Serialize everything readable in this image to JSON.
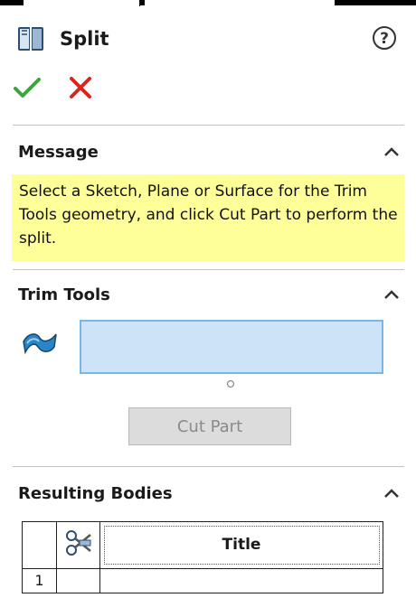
{
  "header": {
    "title": "Split",
    "feature_icon": "split-feature-icon",
    "help_icon": "help-icon"
  },
  "actions": {
    "ok_icon": "green-checkmark-icon",
    "cancel_icon": "red-x-icon"
  },
  "message_section": {
    "title": "Message",
    "text": "Select a Sketch, Plane or Surface for the Trim Tools geometry, and click Cut Part to perform the split.",
    "background_color": "#ffff99"
  },
  "trim_tools_section": {
    "title": "Trim Tools",
    "selection_value": "",
    "cut_button_label": "Cut Part"
  },
  "resulting_bodies_section": {
    "title": "Resulting Bodies",
    "table": {
      "columns": [
        "",
        "",
        "Title"
      ],
      "header_icon": "scissors-icon",
      "rows": [
        {
          "number": "1",
          "icon_cell": "",
          "title": ""
        }
      ]
    }
  },
  "colors": {
    "accent_check": "#3aa53a",
    "accent_cancel": "#d9261c",
    "selection_fill": "#cde3f8",
    "selection_border": "#78b6ea"
  }
}
